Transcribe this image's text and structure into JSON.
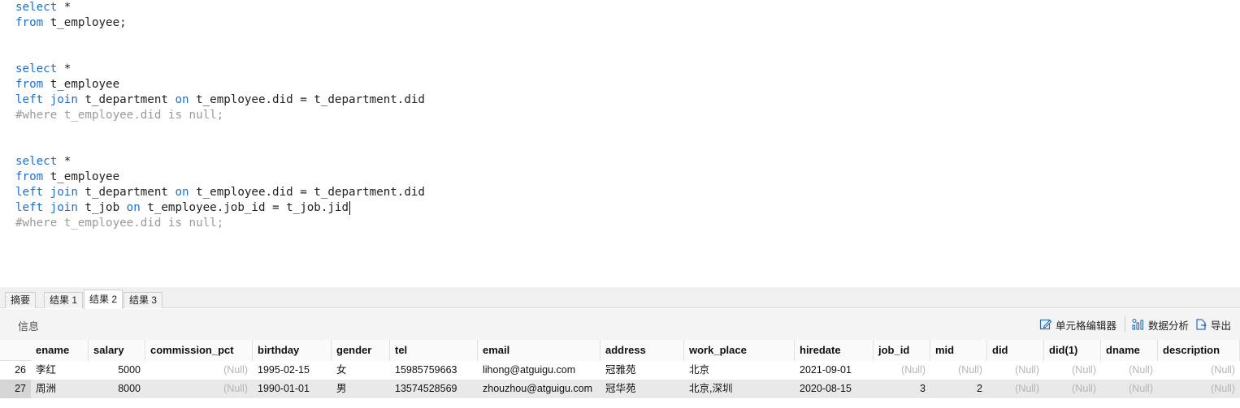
{
  "editor": {
    "lines": [
      {
        "row": 0,
        "parts": [
          {
            "t": "select",
            "c": "kw"
          },
          {
            "t": " *",
            "c": ""
          }
        ]
      },
      {
        "row": 1,
        "parts": [
          {
            "t": "from",
            "c": "kw"
          },
          {
            "t": " t_employee;",
            "c": ""
          }
        ]
      },
      {
        "row": 4,
        "parts": [
          {
            "t": "select",
            "c": "kw"
          },
          {
            "t": " *",
            "c": ""
          }
        ]
      },
      {
        "row": 5,
        "parts": [
          {
            "t": "from",
            "c": "kw"
          },
          {
            "t": " t_employee",
            "c": ""
          }
        ]
      },
      {
        "row": 6,
        "parts": [
          {
            "t": "left join",
            "c": "kw"
          },
          {
            "t": " t_department ",
            "c": ""
          },
          {
            "t": "on",
            "c": "kw"
          },
          {
            "t": " t_employee.did = t_department.did",
            "c": ""
          }
        ]
      },
      {
        "row": 7,
        "parts": [
          {
            "t": "#where t_employee.did is null;",
            "c": "cm"
          }
        ]
      },
      {
        "row": 10,
        "parts": [
          {
            "t": "select",
            "c": "kw"
          },
          {
            "t": " *",
            "c": ""
          }
        ]
      },
      {
        "row": 11,
        "parts": [
          {
            "t": "from",
            "c": "kw"
          },
          {
            "t": " t_employee",
            "c": ""
          }
        ]
      },
      {
        "row": 12,
        "parts": [
          {
            "t": "left join",
            "c": "kw"
          },
          {
            "t": " t_department ",
            "c": ""
          },
          {
            "t": "on",
            "c": "kw"
          },
          {
            "t": " t_employee.did = t_department.did",
            "c": ""
          }
        ]
      },
      {
        "row": 13,
        "parts": [
          {
            "t": "left join",
            "c": "kw"
          },
          {
            "t": " t_job ",
            "c": ""
          },
          {
            "t": "on",
            "c": "kw"
          },
          {
            "t": " t_employee.job_id = t_job.jid",
            "c": ""
          }
        ],
        "caret": true
      },
      {
        "row": 14,
        "parts": [
          {
            "t": "#where t_employee.did is null;",
            "c": "cm"
          }
        ]
      }
    ]
  },
  "tabs": [
    {
      "label": "摘要",
      "active": false
    },
    {
      "label": "结果 1",
      "active": false
    },
    {
      "label": "结果 2",
      "active": true
    },
    {
      "label": "结果 3",
      "active": false
    }
  ],
  "toolbar": {
    "info_label": "信息",
    "cell_editor_label": "单元格编辑器",
    "data_analysis_label": "数据分析",
    "export_label": "导出"
  },
  "grid": {
    "columns": [
      "ename",
      "salary",
      "commission_pct",
      "birthday",
      "gender",
      "tel",
      "email",
      "address",
      "work_place",
      "hiredate",
      "job_id",
      "mid",
      "did",
      "did(1)",
      "dname",
      "description"
    ],
    "rows": [
      {
        "num": "26",
        "cells": [
          "李红",
          "5000",
          "(Null)",
          "1995-02-15",
          "女",
          "15985759663",
          "lihong@atguigu.com",
          "冠雅苑",
          "北京",
          "2021-09-01",
          "(Null)",
          "(Null)",
          "(Null)",
          "(Null)",
          "(Null)",
          "(Null)"
        ]
      },
      {
        "num": "27",
        "cells": [
          "周洲",
          "8000",
          "(Null)",
          "1990-01-01",
          "男",
          "13574528569",
          "zhouzhou@atguigu.com",
          "冠华苑",
          "北京,深圳",
          "2020-08-15",
          "3",
          "2",
          "(Null)",
          "(Null)",
          "(Null)",
          "(Null)"
        ]
      }
    ]
  }
}
